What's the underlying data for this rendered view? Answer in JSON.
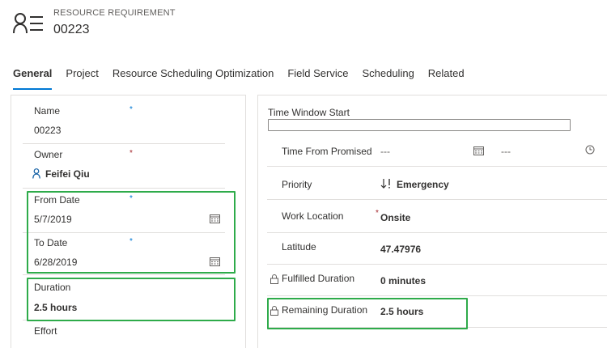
{
  "header": {
    "entity_type": "RESOURCE REQUIREMENT",
    "record_name": "00223"
  },
  "tabs": [
    {
      "label": "General"
    },
    {
      "label": "Project"
    },
    {
      "label": "Resource Scheduling Optimization"
    },
    {
      "label": "Field Service"
    },
    {
      "label": "Scheduling"
    },
    {
      "label": "Related"
    }
  ],
  "left_fields": {
    "name": {
      "label": "Name",
      "value": "00223",
      "required": "*"
    },
    "owner": {
      "label": "Owner",
      "value": "Feifei Qiu",
      "required": "*"
    },
    "from_date": {
      "label": "From Date",
      "value": "5/7/2019",
      "required": "*"
    },
    "to_date": {
      "label": "To Date",
      "value": "6/28/2019",
      "required": "*"
    },
    "duration": {
      "label": "Duration",
      "value": "2.5 hours"
    },
    "effort": {
      "label": "Effort"
    }
  },
  "right_fields": {
    "time_window_start": {
      "label": "Time Window Start",
      "value": ""
    },
    "time_from_promised": {
      "label": "Time From Promised",
      "date_value": "---",
      "time_value": "---"
    },
    "priority": {
      "label": "Priority",
      "value": "Emergency"
    },
    "work_location": {
      "label": "Work Location",
      "value": "Onsite",
      "required": "*"
    },
    "latitude": {
      "label": "Latitude",
      "value": "47.47976"
    },
    "fulfilled_duration": {
      "label": "Fulfilled Duration",
      "value": "0 minutes"
    },
    "remaining_duration": {
      "label": "Remaining Duration",
      "value": "2.5 hours"
    }
  },
  "colors": {
    "accent": "#0078d4",
    "link": "#115ea3",
    "highlight": "#2eab4a",
    "required_red": "#a4262c"
  }
}
